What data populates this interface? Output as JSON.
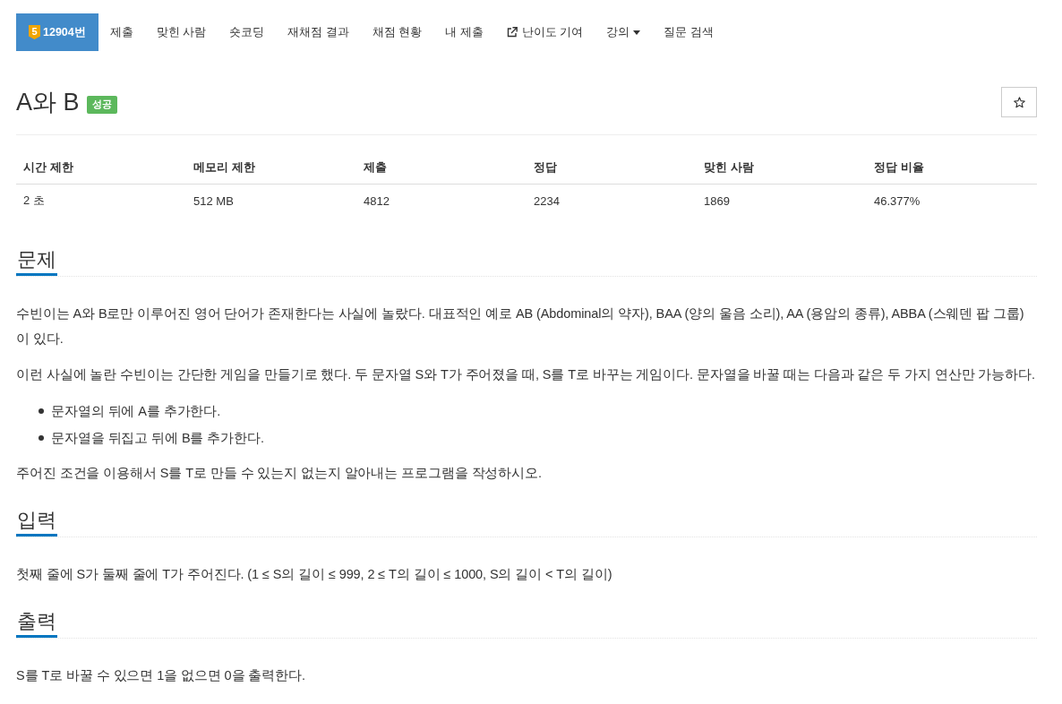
{
  "nav": {
    "tabs": [
      {
        "kind": "problem",
        "tier": "5",
        "label": "12904번",
        "selected": true
      },
      {
        "kind": "link",
        "label": "제출",
        "selected": false
      },
      {
        "kind": "link",
        "label": "맞힌 사람",
        "selected": false
      },
      {
        "kind": "link",
        "label": "숏코딩",
        "selected": false
      },
      {
        "kind": "link",
        "label": "재채점 결과",
        "selected": false
      },
      {
        "kind": "link",
        "label": "채점 현황",
        "selected": false
      },
      {
        "kind": "link",
        "label": "내 제출",
        "selected": false
      },
      {
        "kind": "external",
        "label": "난이도 기여",
        "selected": false
      },
      {
        "kind": "dropdown",
        "label": "강의",
        "selected": false
      },
      {
        "kind": "link",
        "label": "질문 검색",
        "selected": false
      }
    ]
  },
  "problem": {
    "title": "A와 B",
    "result": "성공",
    "starred": false
  },
  "stats": {
    "columns": [
      "시간 제한",
      "메모리 제한",
      "제출",
      "정답",
      "맞힌 사람",
      "정답 비율"
    ],
    "rows": [
      [
        "2 초",
        "512 MB",
        "4812",
        "2234",
        "1869",
        "46.377%"
      ]
    ]
  },
  "sections": [
    {
      "heading": "문제",
      "blocks": [
        {
          "kind": "paragraph",
          "text": "수빈이는 A와 B로만 이루어진 영어 단어가 존재한다는 사실에 놀랐다. 대표적인 예로 AB (Abdominal의 약자), BAA (양의 울음 소리), AA (용암의 종류), ABBA (스웨덴 팝 그룹)이 있다."
        },
        {
          "kind": "paragraph",
          "text": "이런 사실에 놀란 수빈이는 간단한 게임을 만들기로 했다. 두 문자열 S와 T가 주어졌을 때, S를 T로 바꾸는 게임이다. 문자열을 바꿀 때는 다음과 같은 두 가지 연산만 가능하다."
        },
        {
          "kind": "list",
          "items": [
            "문자열의 뒤에 A를 추가한다.",
            "문자열을 뒤집고 뒤에 B를 추가한다."
          ]
        },
        {
          "kind": "paragraph",
          "text": "주어진 조건을 이용해서 S를 T로 만들 수 있는지 없는지 알아내는 프로그램을 작성하시오."
        }
      ]
    },
    {
      "heading": "입력",
      "blocks": [
        {
          "kind": "paragraph",
          "text": "첫째 줄에 S가 둘째 줄에 T가 주어진다. (1 ≤ S의 길이 ≤ 999, 2 ≤ T의 길이 ≤ 1000, S의 길이 < T의 길이)"
        }
      ]
    },
    {
      "heading": "출력",
      "blocks": [
        {
          "kind": "paragraph",
          "text": "S를 T로 바꿀 수 있으면 1을 없으면 0을 출력한다."
        }
      ]
    }
  ]
}
